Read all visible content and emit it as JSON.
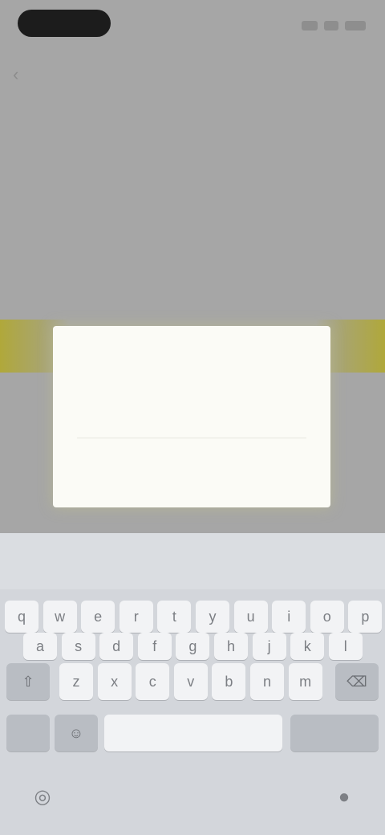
{
  "status_bar": {
    "time": "",
    "icons": [
      "signal-icon",
      "wifi-icon",
      "battery-icon"
    ]
  },
  "background_page": {
    "back_icon": "back-arrow-icon",
    "heading": "",
    "menu_items": [
      "",
      ""
    ],
    "accent_color": "#b0a83a"
  },
  "dialog": {
    "title": "",
    "input_value": "",
    "input_placeholder": "",
    "cancel_label": "",
    "ok_label": ""
  },
  "keyboard": {
    "suggestions": [
      "",
      "",
      ""
    ],
    "row1": [
      "q",
      "w",
      "e",
      "r",
      "t",
      "y",
      "u",
      "i",
      "o",
      "p"
    ],
    "row2": [
      "a",
      "s",
      "d",
      "f",
      "g",
      "h",
      "j",
      "k",
      "l"
    ],
    "row3": [
      "z",
      "x",
      "c",
      "v",
      "b",
      "n",
      "m"
    ],
    "shift_icon": "shift-icon",
    "backspace_icon": "backspace-icon",
    "numbers_label": "",
    "emoji_icon": "emoji-icon",
    "space_label": "",
    "return_label": "",
    "globe_icon": "globe-icon",
    "mic_icon": "mic-icon"
  }
}
